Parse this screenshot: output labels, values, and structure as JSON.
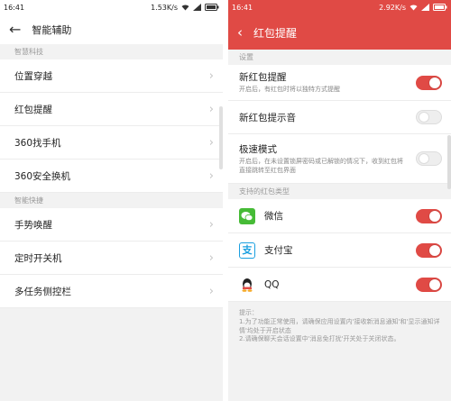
{
  "left": {
    "status": {
      "time": "16:41",
      "speed": "1.53K/s"
    },
    "header": {
      "title": "智能辅助"
    },
    "sections": [
      {
        "label": "智慧科技",
        "items": [
          "位置穿越",
          "红包提醒",
          "360找手机",
          "360安全换机"
        ]
      },
      {
        "label": "智能快捷",
        "items": [
          "手势唤醒",
          "定时开关机",
          "多任务侧控栏"
        ]
      }
    ]
  },
  "right": {
    "status": {
      "time": "16:41",
      "speed": "2.92K/s"
    },
    "header": {
      "title": "红包提醒"
    },
    "section_settings": "设置",
    "new_reminder": {
      "label": "新红包提醒",
      "sub": "开启后，有红包时将以独特方式提醒",
      "on": true
    },
    "sound": {
      "label": "新红包提示音",
      "on": false
    },
    "fast_mode": {
      "label": "极速模式",
      "sub": "开启后，在未设置锁屏密码或已解锁的情况下，收到红包将直接跳转至红包界面",
      "on": false
    },
    "section_types": "支持的红包类型",
    "apps": [
      {
        "label": "微信",
        "icon": "wechat-icon",
        "on": true
      },
      {
        "label": "支付宝",
        "icon": "alipay-icon",
        "on": true
      },
      {
        "label": "QQ",
        "icon": "qq-icon",
        "on": true
      }
    ],
    "tip": {
      "title": "提示：",
      "line1": "1.为了功能正常使用，请确保应用设置内'接收新消息通知'和'显示通知详情'均处于开启状态",
      "line2": "2.请确保聊天会话设置中'消息免打扰'开关处于关闭状态。"
    },
    "accent": "#e04a45"
  }
}
